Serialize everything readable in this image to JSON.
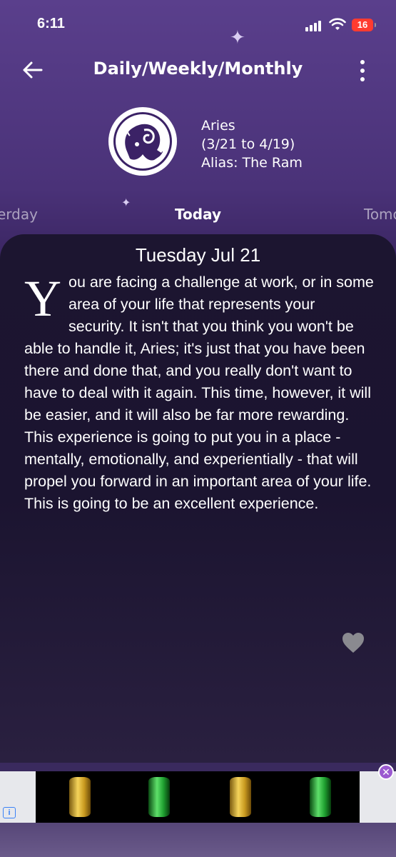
{
  "status_bar": {
    "time": "6:11",
    "battery": "16"
  },
  "nav": {
    "title": "Daily/Weekly/Monthly"
  },
  "sign": {
    "name": "Aries",
    "dates": "(3/21 to 4/19)",
    "alias": "Alias: The Ram"
  },
  "tabs": {
    "prev": "erday",
    "current": "Today",
    "next": "Tomo"
  },
  "reading": {
    "date": "Tuesday Jul 21",
    "drop_cap": "Y",
    "text": "ou are facing a challenge at work, or in some area of your life that represents your security. It isn't that you think you won't be able to handle it, Aries; it's just that you have been there and done that, and you really don't want to have to deal with it again. This time, however, it will be easier, and it will also be far more rewarding. This experience is going to put you in a place - mentally, emotionally, and experientially - that will propel you forward in an important area of your life. This is going to be an excellent experience."
  },
  "ad": {
    "info_label": "i",
    "close_label": "✕"
  },
  "colors": {
    "accent_purple": "#9b59d0",
    "battery_red": "#ff3b30"
  }
}
